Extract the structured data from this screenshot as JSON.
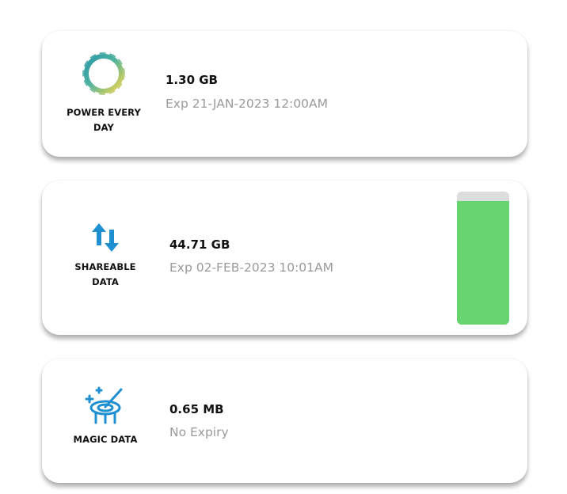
{
  "colors": {
    "accent_blue": "#1e8fd0",
    "bar_fill": "#66d56f",
    "bar_track": "#dddddd",
    "expiry_text": "#9a9a9a"
  },
  "plans": [
    {
      "icon": "power-every-day-ring-icon",
      "name": "POWER EVERY DAY",
      "amount": "1.30 GB",
      "expiry": "Exp 21-JAN-2023 12:00AM"
    },
    {
      "icon": "up-down-arrows-icon",
      "name": "SHAREABLE DATA",
      "amount": "44.71 GB",
      "expiry": "Exp 02-FEB-2023 10:01AM",
      "remaining_fraction": 0.93
    },
    {
      "icon": "magic-wand-icon",
      "name": "MAGIC DATA",
      "amount": "0.65 MB",
      "expiry": "No Expiry"
    }
  ]
}
